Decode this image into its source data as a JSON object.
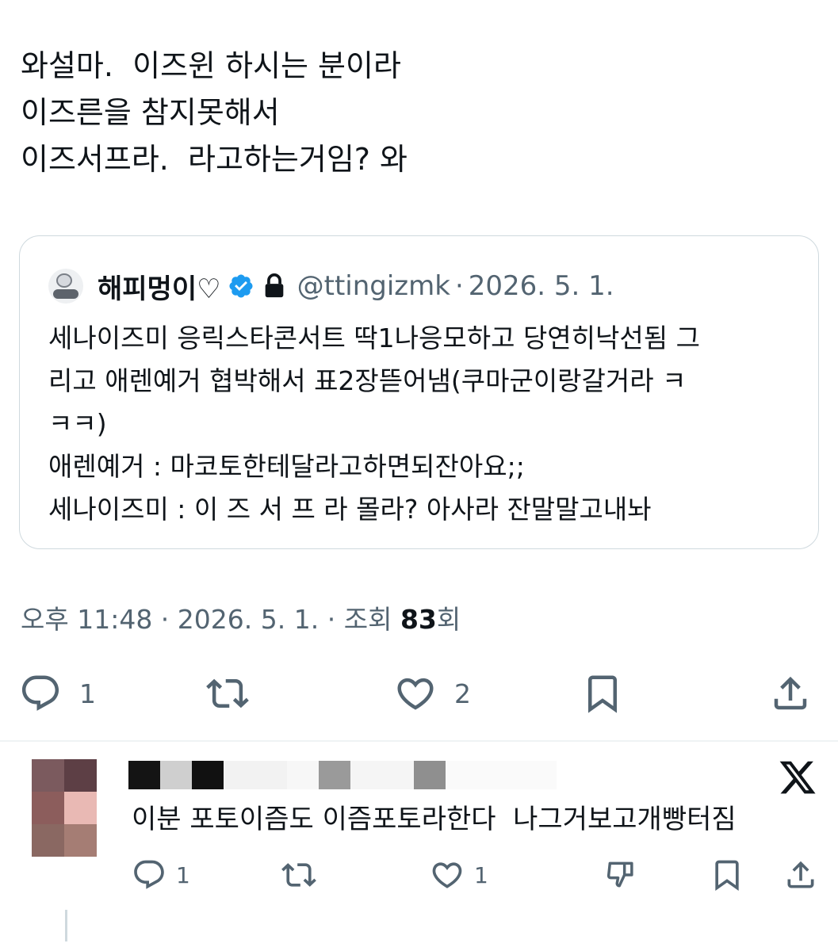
{
  "tweet": {
    "lines": [
      "와설마.  이즈윈 하시는 분이라",
      "이즈른을 참지못해서",
      "이즈서프라.  라고하는거임? 와"
    ]
  },
  "quote": {
    "name": "해피멍이♡",
    "handle": "@ttingizmk",
    "separator": "·",
    "date": "2026. 5. 1.",
    "body_lines": [
      "세나이즈미 응릭스타콘서트 딱1나응모하고 당연히낙선됨 그",
      "리고 애렌예거 협박해서 표2장뜯어냄(쿠마군이랑갈거라 ㅋ",
      "ㅋㅋ)",
      "애렌예거 : 마코토한테달라고하면되잔아요;;",
      "세나이즈미 : 이 즈 서 프 라 몰라? 아사라 잔말말고내놔"
    ]
  },
  "meta": {
    "time": "오후 11:48",
    "separator": " · ",
    "date": "2026. 5. 1.",
    "views_label": "조회",
    "views_count": "83",
    "views_suffix": "회"
  },
  "actions": {
    "reply_count": "1",
    "retweet_count": "",
    "like_count": "2"
  },
  "reply": {
    "text": "이분 포토이즘도 이즘포토라한다  나그거보고개빵터짐",
    "reply_count": "1",
    "like_count": "1",
    "blur_colors": [
      "#7b5a5e",
      "#5d3f45",
      "#8c5d5c",
      "#e9b9b4",
      "#8a6862",
      "#a57d74"
    ]
  },
  "colors": {
    "text_primary": "#0f1419",
    "text_secondary": "#536471",
    "verified_blue": "#1d9bf0",
    "border": "#cfd9de"
  }
}
